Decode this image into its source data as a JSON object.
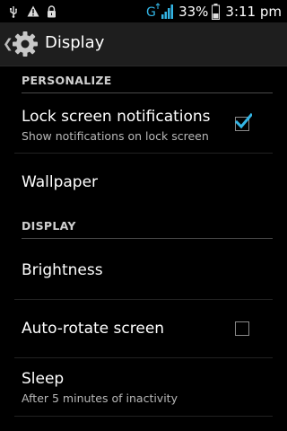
{
  "status_bar": {
    "icons_left": [
      "usb-icon",
      "warning-icon",
      "lock-icon"
    ],
    "network_label": "G",
    "battery_percent": "33%",
    "time": "3:11 pm"
  },
  "action_bar": {
    "title": "Display"
  },
  "sections": [
    {
      "header": "PERSONALIZE"
    },
    {
      "header": "DISPLAY"
    }
  ],
  "items": {
    "lock_screen": {
      "title": "Lock screen notifications",
      "subtitle": "Show notifications on lock screen",
      "checked": true
    },
    "wallpaper": {
      "title": "Wallpaper"
    },
    "brightness": {
      "title": "Brightness"
    },
    "auto_rotate": {
      "title": "Auto-rotate screen",
      "checked": false
    },
    "sleep": {
      "title": "Sleep",
      "subtitle": "After 5 minutes of inactivity"
    }
  },
  "colors": {
    "accent": "#33b5e5",
    "background": "#000000",
    "action_bar": "#1e1e1e"
  }
}
